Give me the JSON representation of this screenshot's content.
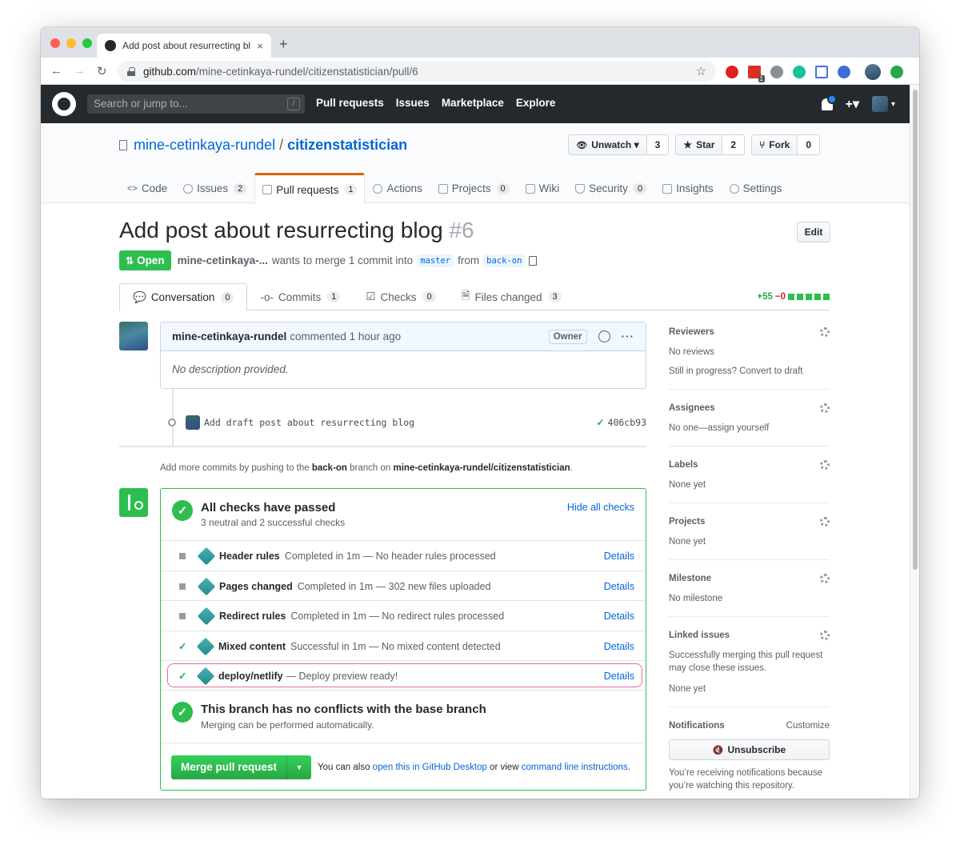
{
  "browser": {
    "tab_title": "Add post about resurrecting bl",
    "tab_close": "×",
    "new_tab": "+",
    "url_host": "github.com",
    "url_path": "/mine-cetinkaya-rundel/citizenstatistician/pull/6",
    "back": "←",
    "forward": "→",
    "reload": "↻",
    "star": "☆",
    "extension_badge": "1"
  },
  "gh_header": {
    "search_placeholder": "Search or jump to...",
    "search_key": "/",
    "nav": [
      "Pull requests",
      "Issues",
      "Marketplace",
      "Explore"
    ],
    "plus": "+▾",
    "avatar_caret": "▾"
  },
  "repo": {
    "owner": "mine-cetinkaya-rundel",
    "separator": "/",
    "name": "citizenstatistician",
    "watch_label": "Unwatch ▾",
    "watch_count": "3",
    "star_label": "Star",
    "star_count": "2",
    "fork_label": "Fork",
    "fork_count": "0",
    "nav": [
      {
        "label": "Code",
        "count": ""
      },
      {
        "label": "Issues",
        "count": "2"
      },
      {
        "label": "Pull requests",
        "count": "1"
      },
      {
        "label": "Actions",
        "count": ""
      },
      {
        "label": "Projects",
        "count": "0"
      },
      {
        "label": "Wiki",
        "count": ""
      },
      {
        "label": "Security",
        "count": "0"
      },
      {
        "label": "Insights",
        "count": ""
      },
      {
        "label": "Settings",
        "count": ""
      }
    ]
  },
  "pr": {
    "title": "Add post about resurrecting blog",
    "number": "#6",
    "edit_label": "Edit",
    "state": "Open",
    "author": "mine-cetinkaya-...",
    "meta_text": "wants to merge 1 commit into",
    "base_branch": "master",
    "from_text": "from",
    "head_branch": "back-on",
    "tabs": [
      {
        "label": "Conversation",
        "count": "0"
      },
      {
        "label": "Commits",
        "count": "1"
      },
      {
        "label": "Checks",
        "count": "0"
      },
      {
        "label": "Files changed",
        "count": "3"
      }
    ],
    "additions": "+55",
    "deletions": "−0"
  },
  "comment": {
    "author": "mine-cetinkaya-rundel",
    "action": "commented 1 hour ago",
    "role": "Owner",
    "more": "···",
    "body": "No description provided."
  },
  "commit": {
    "message": "Add draft post about resurrecting blog",
    "check": "✓",
    "sha": "406cb93"
  },
  "push_note": {
    "prefix": "Add more commits by pushing to the",
    "branch": "back-on",
    "middle": "branch on",
    "repo": "mine-cetinkaya-rundel/citizenstatistician",
    "suffix": "."
  },
  "checks": {
    "title": "All checks have passed",
    "subtitle": "3 neutral and 2 successful checks",
    "hide_label": "Hide all checks",
    "icon": "✓",
    "details_label": "Details",
    "rows": [
      {
        "status": "neutral",
        "icon": "",
        "name": "Header rules",
        "desc": "Completed in 1m — No header rules processed"
      },
      {
        "status": "neutral",
        "icon": "",
        "name": "Pages changed",
        "desc": "Completed in 1m — 302 new files uploaded"
      },
      {
        "status": "neutral",
        "icon": "",
        "name": "Redirect rules",
        "desc": "Completed in 1m — No redirect rules processed"
      },
      {
        "status": "success",
        "icon": "✓",
        "name": "Mixed content",
        "desc": "Successful in 1m — No mixed content detected"
      },
      {
        "status": "success",
        "icon": "✓",
        "name": "deploy/netlify",
        "desc": "— Deploy preview ready!"
      }
    ]
  },
  "conflicts": {
    "title": "This branch has no conflicts with the base branch",
    "subtitle": "Merging can be performed automatically."
  },
  "merge": {
    "button": "Merge pull request",
    "caret": "▼",
    "text1": "You can also",
    "link1": "open this in GitHub Desktop",
    "text2": "or view",
    "link2": "command line instructions",
    "text3": "."
  },
  "sidebar": {
    "reviewers": {
      "title": "Reviewers",
      "line1": "No reviews",
      "line2": "Still in progress? Convert to draft"
    },
    "assignees": {
      "title": "Assignees",
      "value": "No one—assign yourself"
    },
    "labels": {
      "title": "Labels",
      "value": "None yet"
    },
    "projects": {
      "title": "Projects",
      "value": "None yet"
    },
    "milestone": {
      "title": "Milestone",
      "value": "No milestone"
    },
    "linked": {
      "title": "Linked issues",
      "line1": "Successfully merging this pull request may close these issues.",
      "line2": "None yet"
    },
    "notifications": {
      "title": "Notifications",
      "customize": "Customize",
      "button": "Unsubscribe",
      "button_icon": "🔇",
      "note": "You’re receiving notifications because you’re watching this repository."
    }
  },
  "colors": {
    "success": "#2cbe4e",
    "link": "#0366d6",
    "header_bg": "#24292e",
    "highlight": "#e56f9a"
  }
}
